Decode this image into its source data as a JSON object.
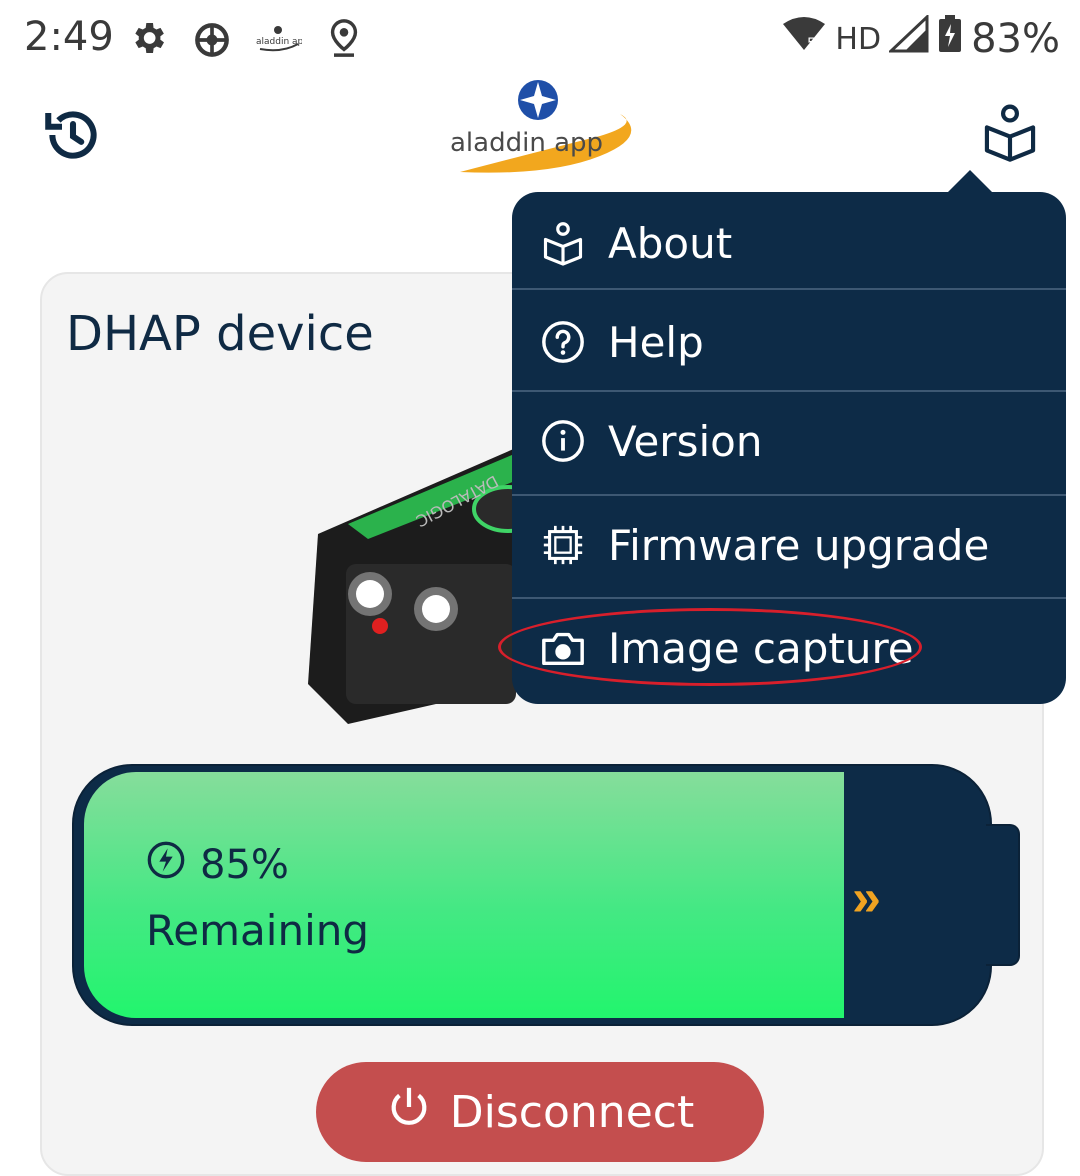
{
  "status_bar": {
    "time": "2:49",
    "network": "HD",
    "battery": "83%",
    "icons": [
      "gear-icon",
      "settings-wheel-icon",
      "aladdin-app-notification-icon",
      "location-pin-icon"
    ]
  },
  "header": {
    "logo_text": "aladdin app",
    "history_icon": "history-icon",
    "about_icon": "book-person-icon"
  },
  "device_card": {
    "title": "DHAP device",
    "image_text": "DATALOGIC"
  },
  "battery": {
    "percent": "85%",
    "level_fraction": 0.85,
    "label": "Remaining",
    "arrow": "»"
  },
  "disconnect": {
    "label": "Disconnect"
  },
  "menu": {
    "items": [
      {
        "label": "About",
        "icon": "book-person-icon"
      },
      {
        "label": "Help",
        "icon": "help-circle-icon"
      },
      {
        "label": "Version",
        "icon": "info-circle-icon"
      },
      {
        "label": "Firmware upgrade",
        "icon": "chip-icon"
      },
      {
        "label": "Image capture",
        "icon": "camera-icon"
      }
    ]
  },
  "colors": {
    "menu_bg": "#0d2b47",
    "accent_orange": "#f0a321",
    "battery_green": "#22f56d",
    "disconnect_red": "#c44e4e",
    "annotation_red": "#d81f2b"
  }
}
